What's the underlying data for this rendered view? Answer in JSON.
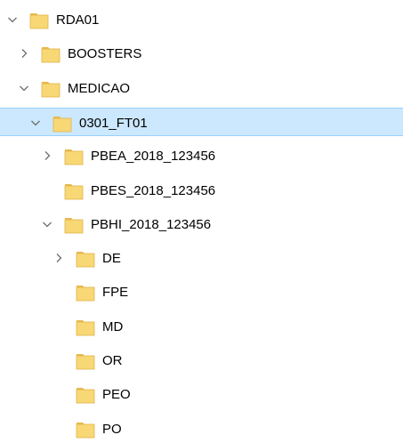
{
  "colors": {
    "selection_background": "#cce8ff",
    "selection_border": "#99d1ff",
    "folder_body": "#f8d775",
    "folder_back": "#e8b94a",
    "chevron": "#6d6d6d",
    "text": "#000000"
  },
  "icons": {
    "expanded": "chevron-down-icon",
    "collapsed": "chevron-right-icon",
    "folder": "folder-icon"
  },
  "tree": {
    "items": [
      {
        "label": "RDA01",
        "depth": 0,
        "state": "expanded",
        "selected": false
      },
      {
        "label": "BOOSTERS",
        "depth": 1,
        "state": "collapsed",
        "selected": false
      },
      {
        "label": "MEDICAO",
        "depth": 1,
        "state": "expanded",
        "selected": false
      },
      {
        "label": "0301_FT01",
        "depth": 2,
        "state": "expanded",
        "selected": true
      },
      {
        "label": "PBEA_2018_123456",
        "depth": 3,
        "state": "collapsed",
        "selected": false
      },
      {
        "label": "PBES_2018_123456",
        "depth": 3,
        "state": "none",
        "selected": false
      },
      {
        "label": "PBHI_2018_123456",
        "depth": 3,
        "state": "expanded",
        "selected": false
      },
      {
        "label": "DE",
        "depth": 4,
        "state": "collapsed",
        "selected": false
      },
      {
        "label": "FPE",
        "depth": 4,
        "state": "none",
        "selected": false
      },
      {
        "label": "MD",
        "depth": 4,
        "state": "none",
        "selected": false
      },
      {
        "label": "OR",
        "depth": 4,
        "state": "none",
        "selected": false
      },
      {
        "label": "PEO",
        "depth": 4,
        "state": "none",
        "selected": false
      },
      {
        "label": "PO",
        "depth": 4,
        "state": "none",
        "selected": false
      }
    ]
  }
}
